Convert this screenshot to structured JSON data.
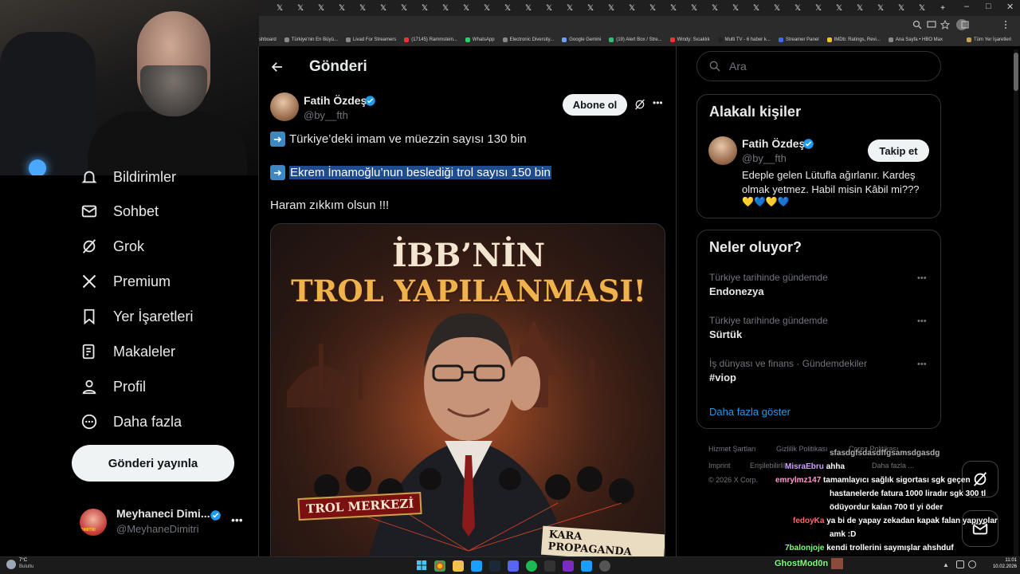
{
  "browser": {
    "tab_glyph": "𝕏",
    "new_tab": "+",
    "bookmarks": [
      "shboard",
      "Türkiye'nin En Büyü...",
      "Livad For Streamers",
      "(17145) Rammstein...",
      "WhatsApp",
      "Electronic Diversity...",
      "Google Gemini",
      "(19) Alert Box / Stre...",
      "Windy: Sıcaklık",
      "Multi TV - 6 haber k...",
      "Streamer Panel",
      "IMDb: Ratings, Revi...",
      "Ana Sayfa • HBO Max",
      "Tüm Yer İşaretleri"
    ]
  },
  "nav": {
    "items": [
      {
        "label": "Bildirimler",
        "icon": "bell-icon"
      },
      {
        "label": "Sohbet",
        "icon": "mail-icon"
      },
      {
        "label": "Grok",
        "icon": "grok-icon"
      },
      {
        "label": "Premium",
        "icon": "x-logo-icon"
      },
      {
        "label": "Yer İşaretleri",
        "icon": "bookmark-icon"
      },
      {
        "label": "Makaleler",
        "icon": "article-icon"
      },
      {
        "label": "Profil",
        "icon": "person-icon"
      },
      {
        "label": "Daha fazla",
        "icon": "more-circle-icon"
      }
    ],
    "post_button": "Gönderi yayınla",
    "account": {
      "name": "Meyhaneci Dimi...",
      "handle": "@MeyhaneDimitri",
      "avatar_text": "DIMITRI"
    }
  },
  "header": {
    "title": "Gönderi"
  },
  "post": {
    "author": "Fatih Özdeş",
    "handle": "@by__fth",
    "subscribe": "Abone ol",
    "line1": "Türkiye’deki imam ve müezzin sayısı 130 bin",
    "line2": "Ekrem İmamoğlu’nun beslediği trol sayısı 150 bin",
    "line3": "Haram zıkkım olsun !!!",
    "image": {
      "headline1": "İBB’NİN",
      "headline2": "TROL YAPILANMASI!",
      "label_left": "TROL MERKEZİ",
      "label_right": "KARA PROPAGANDA"
    }
  },
  "search": {
    "placeholder": "Ara"
  },
  "related": {
    "title": "Alakalı kişiler",
    "name": "Fatih Özdeş",
    "handle": "@by__fth",
    "follow": "Takip et",
    "bio": "Edeple gelen Lütufla ağırlanır. Kardeş olmak yetmez. Habil misin Kâbil mi???",
    "hearts": "💛💙💛💙"
  },
  "trends": {
    "title": "Neler oluyor?",
    "items": [
      {
        "context": "Türkiye tarihinde gündemde",
        "name": "Endonezya"
      },
      {
        "context": "Türkiye tarihinde gündemde",
        "name": "Sürtük"
      },
      {
        "context": "İş dünyası ve finans · Gündemdekiler",
        "name": "#viop"
      }
    ],
    "show_more": "Daha fazla göster"
  },
  "footer": {
    "links": [
      "Hizmet Şartları",
      "Gizlilik Politikası",
      "Çerez Politikası",
      "Imprint",
      "Erişilebilirlik",
      "Daha fazla ..."
    ],
    "copyright": "© 2026 X Corp."
  },
  "chat": [
    {
      "user": "",
      "msg": "sfasdgfsdasdffgsamsdgasdg",
      "color": "#ffffff"
    },
    {
      "user": "MisraEbru",
      "msg": "ahha",
      "color": "#d0a0ff"
    },
    {
      "user": "emrylmz147",
      "msg": "tamamlayıcı sağlık sigortası sgk geçen",
      "color": "#ff9bd2"
    },
    {
      "user": "",
      "msg": "hastanelerde fatura 1000 liradır sgk 300 tl",
      "color": "#ffffff"
    },
    {
      "user": "",
      "msg": "ödüyordur kalan 700 tl yi öder",
      "color": "#ffffff"
    },
    {
      "user": "fedoyKa",
      "msg": "ya bi de yapay zekadan kapak falan yapıyolar",
      "color": "#ff6a6a"
    },
    {
      "user": "",
      "msg": "amk :D",
      "color": "#ffffff"
    },
    {
      "user": "7balonjoje",
      "msg": "kendi trollerini saymışlar ahshduf",
      "color": "#7cff7c"
    },
    {
      "user": "GhostMod0n",
      "msg": "",
      "color": "#7cff7c"
    }
  ],
  "taskbar": {
    "weather_temp": "7°C",
    "weather_desc": "Bulutlu",
    "time": "11:01",
    "date": "10.02.2026"
  }
}
